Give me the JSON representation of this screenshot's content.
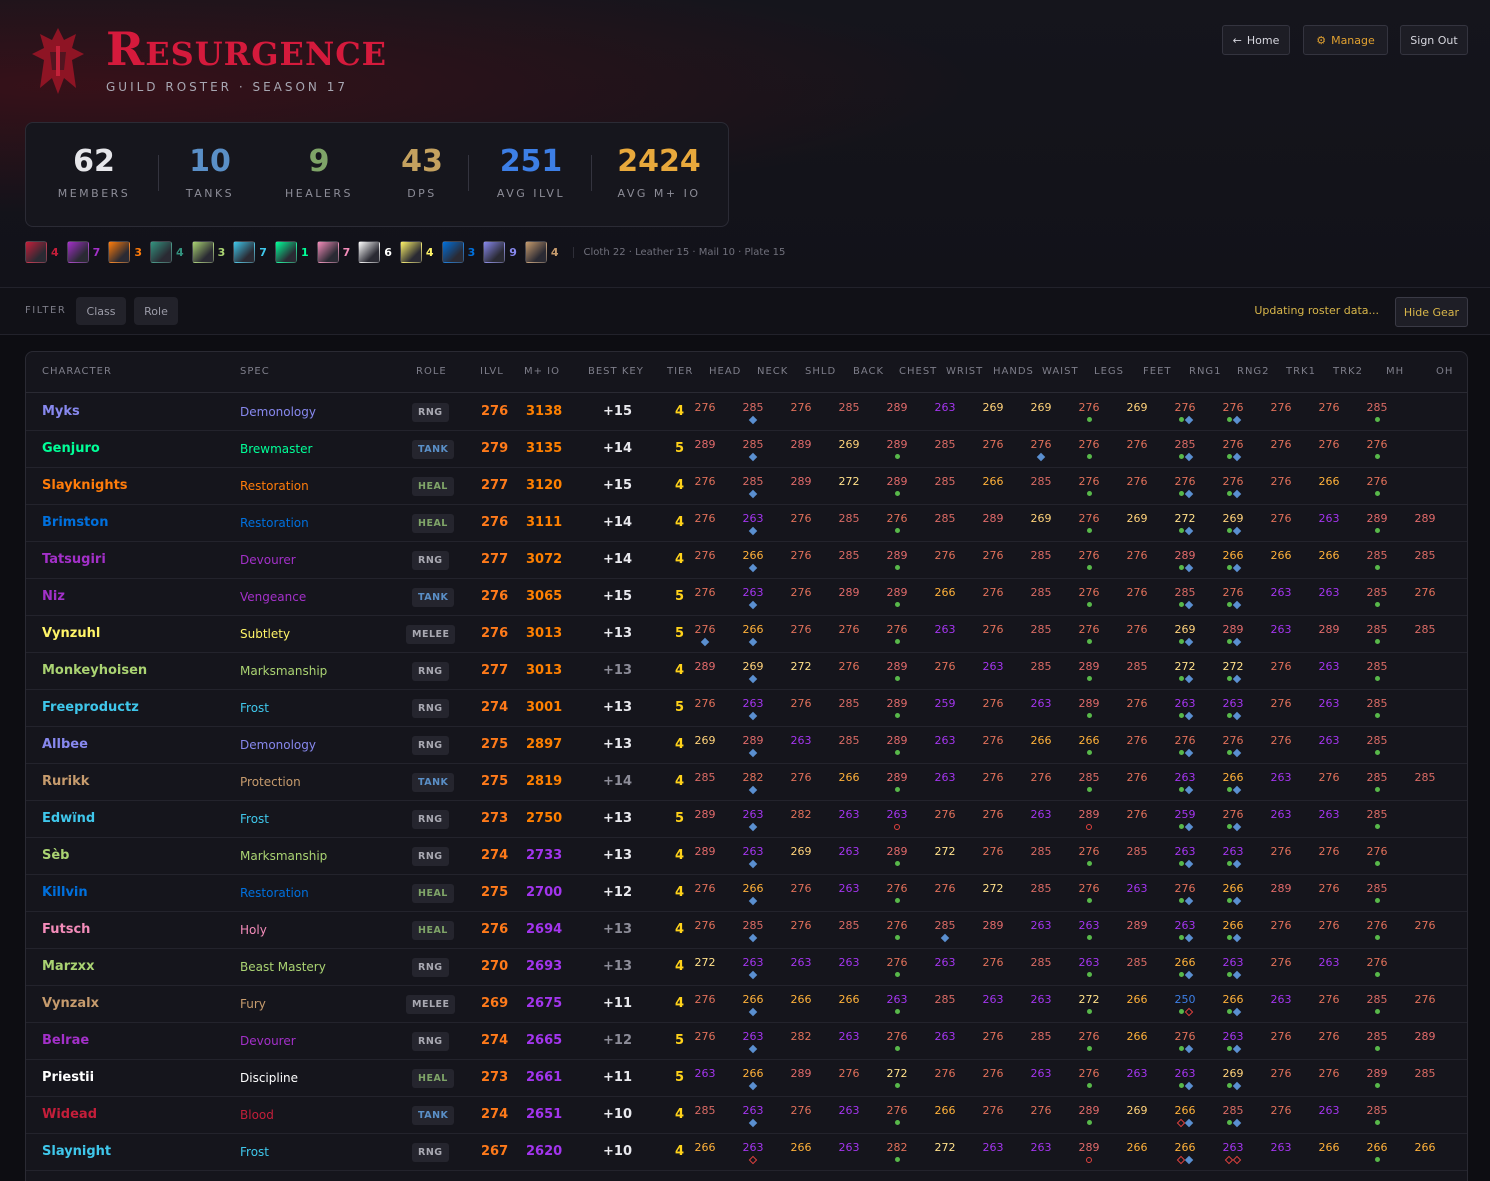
{
  "header": {
    "title": "Resurgence",
    "subtitle": "GUILD ROSTER · SEASON 17",
    "buttons": {
      "home": "Home",
      "manage": "Manage",
      "signout": "Sign Out"
    }
  },
  "stats": [
    {
      "value": "62",
      "label": "MEMBERS",
      "color": "#e6e6ea"
    },
    {
      "value": "10",
      "label": "TANKS",
      "color": "#5a8fc7"
    },
    {
      "value": "9",
      "label": "HEALERS",
      "color": "#7fa468"
    },
    {
      "value": "43",
      "label": "DPS",
      "color": "#c4a15f"
    },
    {
      "value": "251",
      "label": "AVG ILVL",
      "color": "#3d7fe6"
    },
    {
      "value": "2424",
      "label": "AVG M+ IO",
      "color": "#e8a93c"
    }
  ],
  "classes": [
    {
      "icon": "death-knight-icon",
      "count": "4",
      "color": "#c41e3a"
    },
    {
      "icon": "demon-hunter-icon",
      "count": "7",
      "color": "#a330c9"
    },
    {
      "icon": "druid-icon",
      "count": "3",
      "color": "#ff7c0a"
    },
    {
      "icon": "evoker-icon",
      "count": "4",
      "color": "#33937f"
    },
    {
      "icon": "hunter-icon",
      "count": "3",
      "color": "#aad372"
    },
    {
      "icon": "mage-icon",
      "count": "7",
      "color": "#3fc7eb"
    },
    {
      "icon": "monk-icon",
      "count": "1",
      "color": "#00ff98"
    },
    {
      "icon": "paladin-icon",
      "count": "7",
      "color": "#f48cba"
    },
    {
      "icon": "priest-icon",
      "count": "6",
      "color": "#ffffff"
    },
    {
      "icon": "rogue-icon",
      "count": "4",
      "color": "#fff468"
    },
    {
      "icon": "shaman-icon",
      "count": "3",
      "color": "#0070dd"
    },
    {
      "icon": "warlock-icon",
      "count": "9",
      "color": "#8788ee"
    },
    {
      "icon": "warrior-icon",
      "count": "4",
      "color": "#c69b6d"
    }
  ],
  "armor_summary": "Cloth 22 · Leather 15 · Mail 10 · Plate 15",
  "filter": {
    "label": "FILTER",
    "class_btn": "Class",
    "role_btn": "Role",
    "status": "Updating roster data...",
    "hide_gear": "Hide Gear"
  },
  "columns": [
    "CHARACTER",
    "SPEC",
    "ROLE",
    "ILVL",
    "M+ IO",
    "BEST KEY",
    "TIER",
    "HEAD",
    "NECK",
    "SHLD",
    "BACK",
    "CHEST",
    "WRIST",
    "HANDS",
    "WAIST",
    "LEGS",
    "FEET",
    "RNG1",
    "RNG2",
    "TRK1",
    "TRK2",
    "MH",
    "OH"
  ],
  "colors": {
    "gear": {
      "250": "#3d7fe6",
      "259": "#a335ee",
      "263": "#a335ee",
      "266": "#ffb13a",
      "269": "#ffd27a",
      "272": "#ffe08a",
      "276": "#e0705a",
      "282": "#e0705a",
      "285": "#d86a64",
      "289": "#e06a6a",
      "279": "#e0705a"
    },
    "io_high": "#ff8000",
    "io_mid": "#a335ee"
  },
  "rows": [
    {
      "name": "Myks",
      "cls": "#8788ee",
      "spec": "Demonology",
      "role": "RNG",
      "ilvl": "276",
      "io": "3138",
      "key": "+15",
      "timed": true,
      "tier": "4",
      "gear": [
        "276",
        "285",
        "276",
        "285",
        "289",
        "263",
        "269",
        "269",
        "276",
        "269",
        "276",
        "276",
        "276",
        "276",
        "285",
        ""
      ],
      "marks": [
        "",
        "g",
        "",
        "",
        "",
        "",
        "",
        "",
        "d",
        "",
        "dg",
        "dg",
        "",
        "",
        "d",
        ""
      ]
    },
    {
      "name": "Genjuro",
      "cls": "#00ff98",
      "spec": "Brewmaster",
      "role": "TANK",
      "ilvl": "279",
      "io": "3135",
      "key": "+14",
      "timed": true,
      "tier": "5",
      "gear": [
        "289",
        "285",
        "289",
        "269",
        "289",
        "285",
        "276",
        "276",
        "276",
        "276",
        "285",
        "276",
        "276",
        "276",
        "276",
        ""
      ],
      "marks": [
        "",
        "g",
        "",
        "",
        "d",
        "",
        "",
        "g",
        "d",
        "",
        "dg",
        "dg",
        "",
        "",
        "d",
        ""
      ]
    },
    {
      "name": "Slayknights",
      "cls": "#ff7c0a",
      "spec": "Restoration",
      "role": "HEAL",
      "ilvl": "277",
      "io": "3120",
      "key": "+15",
      "timed": true,
      "tier": "4",
      "gear": [
        "276",
        "285",
        "289",
        "272",
        "289",
        "285",
        "266",
        "285",
        "276",
        "276",
        "276",
        "276",
        "276",
        "266",
        "276",
        ""
      ],
      "marks": [
        "",
        "g",
        "",
        "",
        "d",
        "",
        "",
        "",
        "d",
        "",
        "dg",
        "dg",
        "",
        "",
        "d",
        ""
      ]
    },
    {
      "name": "Brimston",
      "cls": "#0070dd",
      "spec": "Restoration",
      "role": "HEAL",
      "ilvl": "276",
      "io": "3111",
      "key": "+14",
      "timed": true,
      "tier": "4",
      "gear": [
        "276",
        "263",
        "276",
        "285",
        "276",
        "285",
        "289",
        "269",
        "276",
        "269",
        "272",
        "269",
        "276",
        "263",
        "289",
        "289"
      ],
      "marks": [
        "",
        "g",
        "",
        "",
        "d",
        "",
        "",
        "",
        "d",
        "",
        "dg",
        "dg",
        "",
        "",
        "d",
        ""
      ]
    },
    {
      "name": "Tatsugiri",
      "cls": "#a330c9",
      "spec": "Devourer",
      "role": "RNG",
      "ilvl": "277",
      "io": "3072",
      "key": "+14",
      "timed": true,
      "tier": "4",
      "gear": [
        "276",
        "266",
        "276",
        "285",
        "289",
        "276",
        "276",
        "285",
        "276",
        "276",
        "289",
        "266",
        "266",
        "266",
        "285",
        "285"
      ],
      "marks": [
        "",
        "g",
        "",
        "",
        "d",
        "",
        "",
        "",
        "d",
        "",
        "dg",
        "dg",
        "",
        "",
        "d",
        ""
      ]
    },
    {
      "name": "Niz",
      "cls": "#a330c9",
      "spec": "Vengeance",
      "role": "TANK",
      "ilvl": "276",
      "io": "3065",
      "key": "+15",
      "timed": true,
      "tier": "5",
      "gear": [
        "276",
        "263",
        "276",
        "289",
        "289",
        "266",
        "276",
        "285",
        "276",
        "276",
        "285",
        "276",
        "263",
        "263",
        "285",
        "276"
      ],
      "marks": [
        "",
        "g",
        "",
        "",
        "d",
        "",
        "",
        "",
        "d",
        "",
        "dg",
        "dg",
        "",
        "",
        "d",
        ""
      ]
    },
    {
      "name": "Vynzuhl",
      "cls": "#fff468",
      "spec": "Subtlety",
      "role": "MELEE",
      "ilvl": "276",
      "io": "3013",
      "key": "+13",
      "timed": true,
      "tier": "5",
      "gear": [
        "276",
        "266",
        "276",
        "276",
        "276",
        "263",
        "276",
        "285",
        "276",
        "276",
        "269",
        "289",
        "263",
        "289",
        "285",
        "285"
      ],
      "marks": [
        "g",
        "g",
        "",
        "",
        "d",
        "",
        "",
        "",
        "d",
        "",
        "dg",
        "dg",
        "",
        "",
        "d",
        ""
      ]
    },
    {
      "name": "Monkeyhoisen",
      "cls": "#aad372",
      "spec": "Marksmanship",
      "role": "RNG",
      "ilvl": "277",
      "io": "3013",
      "key": "+13",
      "timed": false,
      "tier": "4",
      "gear": [
        "289",
        "269",
        "272",
        "276",
        "289",
        "276",
        "263",
        "285",
        "289",
        "285",
        "272",
        "272",
        "276",
        "263",
        "285",
        ""
      ],
      "marks": [
        "",
        "g",
        "",
        "",
        "d",
        "",
        "",
        "",
        "d",
        "",
        "dg",
        "dg",
        "",
        "",
        "d",
        ""
      ]
    },
    {
      "name": "Freeproductz",
      "cls": "#3fc7eb",
      "spec": "Frost",
      "role": "RNG",
      "ilvl": "274",
      "io": "3001",
      "key": "+13",
      "timed": true,
      "tier": "5",
      "gear": [
        "276",
        "263",
        "276",
        "285",
        "289",
        "259",
        "276",
        "263",
        "289",
        "276",
        "263",
        "263",
        "276",
        "263",
        "285",
        ""
      ],
      "marks": [
        "",
        "g",
        "",
        "",
        "d",
        "",
        "",
        "",
        "d",
        "",
        "dg",
        "dg",
        "",
        "",
        "d",
        ""
      ]
    },
    {
      "name": "Allbee",
      "cls": "#8788ee",
      "spec": "Demonology",
      "role": "RNG",
      "ilvl": "275",
      "io": "2897",
      "key": "+13",
      "timed": true,
      "tier": "4",
      "gear": [
        "269",
        "289",
        "263",
        "285",
        "289",
        "263",
        "276",
        "266",
        "266",
        "276",
        "276",
        "276",
        "276",
        "263",
        "285",
        ""
      ],
      "marks": [
        "",
        "g",
        "",
        "",
        "d",
        "",
        "",
        "",
        "d",
        "",
        "dg",
        "dg",
        "",
        "",
        "d",
        ""
      ]
    },
    {
      "name": "Rurikk",
      "cls": "#c69b6d",
      "spec": "Protection",
      "role": "TANK",
      "ilvl": "275",
      "io": "2819",
      "key": "+14",
      "timed": false,
      "tier": "4",
      "gear": [
        "285",
        "282",
        "276",
        "266",
        "289",
        "263",
        "276",
        "276",
        "285",
        "276",
        "263",
        "266",
        "263",
        "276",
        "285",
        "285"
      ],
      "marks": [
        "",
        "g",
        "",
        "",
        "d",
        "",
        "",
        "",
        "d",
        "",
        "dg",
        "dg",
        "",
        "",
        "d",
        ""
      ]
    },
    {
      "name": "Edwïnd",
      "cls": "#3fc7eb",
      "spec": "Frost",
      "role": "RNG",
      "ilvl": "273",
      "io": "2750",
      "key": "+13",
      "timed": true,
      "tier": "5",
      "gear": [
        "289",
        "263",
        "282",
        "263",
        "263",
        "276",
        "276",
        "263",
        "289",
        "276",
        "259",
        "276",
        "263",
        "263",
        "285",
        ""
      ],
      "marks": [
        "",
        "g",
        "",
        "",
        "r",
        "",
        "",
        "",
        "r",
        "",
        "dg",
        "dg",
        "",
        "",
        "d",
        ""
      ]
    },
    {
      "name": "Sèb",
      "cls": "#aad372",
      "spec": "Marksmanship",
      "role": "RNG",
      "ilvl": "274",
      "io": "2733",
      "key": "+13",
      "timed": true,
      "tier": "4",
      "gear": [
        "289",
        "263",
        "269",
        "263",
        "289",
        "272",
        "276",
        "285",
        "276",
        "285",
        "263",
        "263",
        "276",
        "276",
        "276",
        ""
      ],
      "marks": [
        "",
        "g",
        "",
        "",
        "d",
        "",
        "",
        "",
        "d",
        "",
        "dg",
        "dg",
        "",
        "",
        "d",
        ""
      ]
    },
    {
      "name": "Killvin",
      "cls": "#0070dd",
      "spec": "Restoration",
      "role": "HEAL",
      "ilvl": "275",
      "io": "2700",
      "key": "+12",
      "timed": true,
      "tier": "4",
      "gear": [
        "276",
        "266",
        "276",
        "263",
        "276",
        "276",
        "272",
        "285",
        "276",
        "263",
        "276",
        "266",
        "289",
        "276",
        "285",
        ""
      ],
      "marks": [
        "",
        "g",
        "",
        "",
        "d",
        "",
        "",
        "",
        "d",
        "",
        "dg",
        "dg",
        "",
        "",
        "d",
        ""
      ]
    },
    {
      "name": "Futsch",
      "cls": "#f48cba",
      "spec": "Holy",
      "role": "HEAL",
      "ilvl": "276",
      "io": "2694",
      "key": "+13",
      "timed": false,
      "tier": "4",
      "gear": [
        "276",
        "285",
        "276",
        "285",
        "276",
        "285",
        "289",
        "263",
        "263",
        "289",
        "263",
        "266",
        "276",
        "276",
        "276",
        "276"
      ],
      "marks": [
        "",
        "g",
        "",
        "",
        "d",
        "g",
        "",
        "",
        "d",
        "",
        "dg",
        "dg",
        "",
        "",
        "d",
        ""
      ]
    },
    {
      "name": "Marzxx",
      "cls": "#aad372",
      "spec": "Beast Mastery",
      "role": "RNG",
      "ilvl": "270",
      "io": "2693",
      "key": "+13",
      "timed": false,
      "tier": "4",
      "gear": [
        "272",
        "263",
        "263",
        "263",
        "276",
        "263",
        "276",
        "285",
        "263",
        "285",
        "266",
        "263",
        "276",
        "263",
        "276",
        ""
      ],
      "marks": [
        "",
        "g",
        "",
        "",
        "d",
        "",
        "",
        "",
        "d",
        "",
        "dg",
        "dg",
        "",
        "",
        "d",
        ""
      ]
    },
    {
      "name": "Vynzalx",
      "cls": "#c69b6d",
      "spec": "Fury",
      "role": "MELEE",
      "ilvl": "269",
      "io": "2675",
      "key": "+11",
      "timed": true,
      "tier": "4",
      "gear": [
        "276",
        "266",
        "266",
        "266",
        "263",
        "285",
        "263",
        "263",
        "272",
        "266",
        "250",
        "266",
        "263",
        "276",
        "285",
        "276"
      ],
      "marks": [
        "",
        "g",
        "",
        "",
        "d",
        "",
        "",
        "",
        "d",
        "",
        "do",
        "dg",
        "",
        "",
        "d",
        ""
      ]
    },
    {
      "name": "Belrae",
      "cls": "#a330c9",
      "spec": "Devourer",
      "role": "RNG",
      "ilvl": "274",
      "io": "2665",
      "key": "+12",
      "timed": false,
      "tier": "5",
      "gear": [
        "276",
        "263",
        "282",
        "263",
        "276",
        "263",
        "276",
        "285",
        "276",
        "266",
        "276",
        "263",
        "276",
        "276",
        "285",
        "289"
      ],
      "marks": [
        "",
        "g",
        "",
        "",
        "d",
        "",
        "",
        "",
        "d",
        "",
        "dg",
        "dg",
        "",
        "",
        "d",
        ""
      ]
    },
    {
      "name": "Priestii",
      "cls": "#ffffff",
      "spec": "Discipline",
      "role": "HEAL",
      "ilvl": "273",
      "io": "2661",
      "key": "+11",
      "timed": true,
      "tier": "5",
      "gear": [
        "263",
        "266",
        "289",
        "276",
        "272",
        "276",
        "276",
        "263",
        "276",
        "263",
        "263",
        "269",
        "276",
        "276",
        "289",
        "285"
      ],
      "marks": [
        "",
        "g",
        "",
        "",
        "d",
        "",
        "",
        "",
        "d",
        "",
        "dg",
        "dg",
        "",
        "",
        "d",
        ""
      ]
    },
    {
      "name": "Widead",
      "cls": "#c41e3a",
      "spec": "Blood",
      "role": "TANK",
      "ilvl": "274",
      "io": "2651",
      "key": "+10",
      "timed": true,
      "tier": "4",
      "gear": [
        "285",
        "263",
        "276",
        "263",
        "276",
        "266",
        "276",
        "276",
        "289",
        "269",
        "266",
        "285",
        "276",
        "263",
        "285",
        ""
      ],
      "marks": [
        "",
        "g",
        "",
        "",
        "d",
        "",
        "",
        "",
        "d",
        "",
        "og",
        "dg",
        "",
        "",
        "d",
        ""
      ]
    },
    {
      "name": "Slaynight",
      "cls": "#3fc7eb",
      "spec": "Frost",
      "role": "RNG",
      "ilvl": "267",
      "io": "2620",
      "key": "+10",
      "timed": true,
      "tier": "4",
      "gear": [
        "266",
        "263",
        "266",
        "263",
        "282",
        "272",
        "263",
        "263",
        "289",
        "266",
        "266",
        "263",
        "263",
        "266",
        "266",
        "266"
      ],
      "marks": [
        "",
        "o",
        "",
        "",
        "d",
        "",
        "",
        "",
        "r",
        "",
        "og",
        "oo",
        "",
        "",
        "d",
        ""
      ]
    }
  ]
}
